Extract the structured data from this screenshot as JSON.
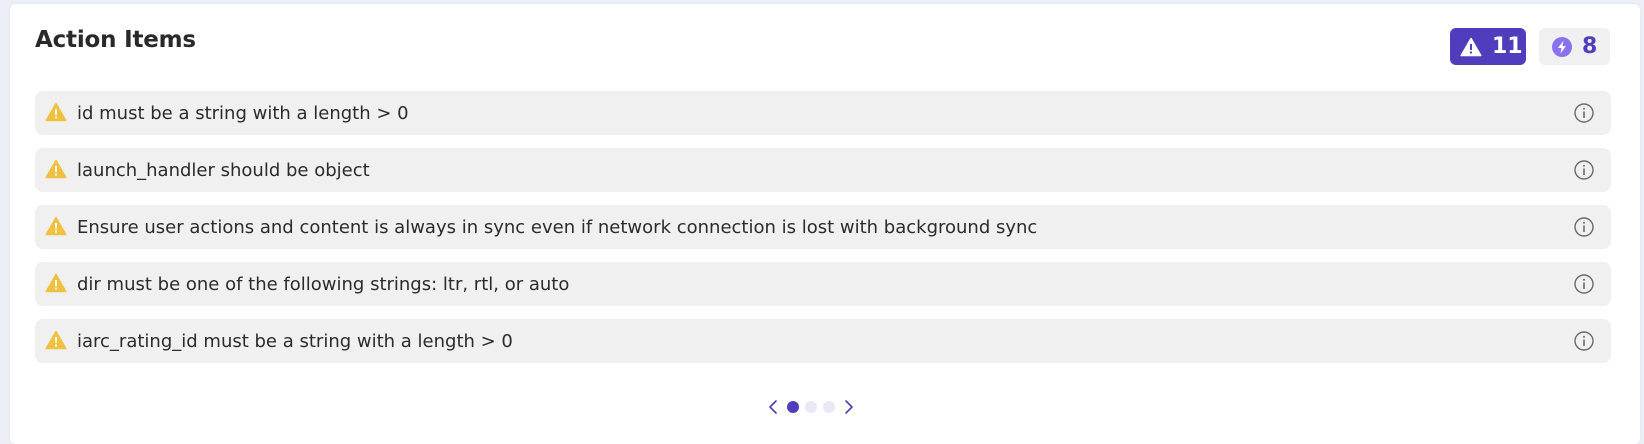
{
  "header": {
    "title": "Action Items",
    "warning_count": "11",
    "boost_count": "8"
  },
  "items": [
    {
      "text": "id must be a string with a length > 0",
      "icon": "warning-icon"
    },
    {
      "text": "launch_handler should be object",
      "icon": "warning-icon"
    },
    {
      "text": "Ensure user actions and content is always in sync even if network connection is lost with background sync",
      "icon": "warning-icon"
    },
    {
      "text": "dir must be one of the following strings: ltr, rtl, or auto",
      "icon": "warning-icon"
    },
    {
      "text": "iarc_rating_id must be a string with a length > 0",
      "icon": "warning-icon"
    }
  ],
  "pagination": {
    "pages": 3,
    "current": 1
  },
  "colors": {
    "accent": "#4f3dbd",
    "warning": "#f0c040",
    "row_bg": "#f0f0f0"
  }
}
